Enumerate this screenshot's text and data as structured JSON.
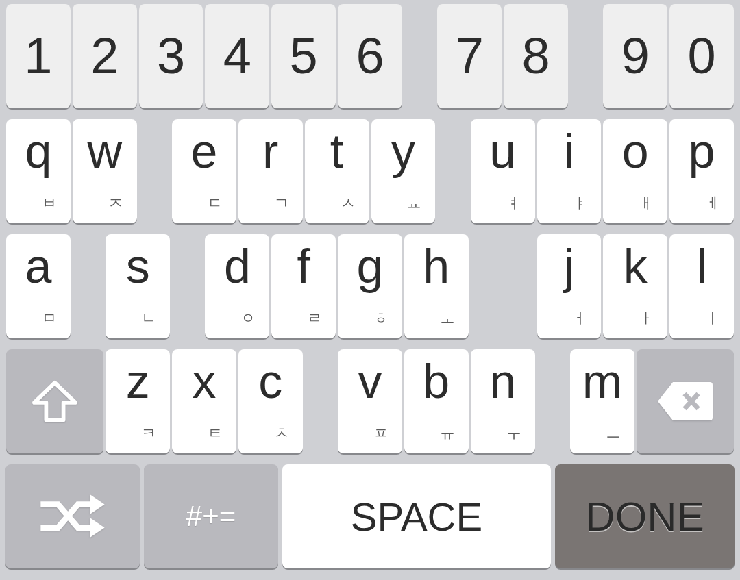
{
  "keyboard": {
    "rows": [
      {
        "keys": [
          {
            "kind": "digit",
            "label": "1"
          },
          {
            "kind": "digit",
            "label": "2"
          },
          {
            "kind": "digit",
            "label": "3"
          },
          {
            "kind": "digit",
            "label": "4"
          },
          {
            "kind": "digit",
            "label": "5"
          },
          {
            "kind": "digit",
            "label": "6"
          },
          {
            "kind": "digit",
            "label": "7"
          },
          {
            "kind": "digit",
            "label": "8"
          },
          {
            "kind": "digit",
            "label": "9"
          },
          {
            "kind": "digit",
            "label": "0"
          }
        ]
      },
      {
        "keys": [
          {
            "kind": "letter",
            "label": "q",
            "hangul": "ㅂ"
          },
          {
            "kind": "letter",
            "label": "w",
            "hangul": "ㅈ"
          },
          {
            "kind": "letter",
            "label": "e",
            "hangul": "ㄷ"
          },
          {
            "kind": "letter",
            "label": "r",
            "hangul": "ㄱ"
          },
          {
            "kind": "letter",
            "label": "t",
            "hangul": "ㅅ"
          },
          {
            "kind": "letter",
            "label": "y",
            "hangul": "ㅛ"
          },
          {
            "kind": "letter",
            "label": "u",
            "hangul": "ㅕ"
          },
          {
            "kind": "letter",
            "label": "i",
            "hangul": "ㅑ"
          },
          {
            "kind": "letter",
            "label": "o",
            "hangul": "ㅐ"
          },
          {
            "kind": "letter",
            "label": "p",
            "hangul": "ㅔ"
          }
        ]
      },
      {
        "keys": [
          {
            "kind": "letter",
            "label": "a",
            "hangul": "ㅁ"
          },
          {
            "kind": "letter",
            "label": "s",
            "hangul": "ㄴ"
          },
          {
            "kind": "letter",
            "label": "d",
            "hangul": "ㅇ"
          },
          {
            "kind": "letter",
            "label": "f",
            "hangul": "ㄹ"
          },
          {
            "kind": "letter",
            "label": "g",
            "hangul": "ㅎ"
          },
          {
            "kind": "letter",
            "label": "h",
            "hangul": "ㅗ"
          },
          {
            "kind": "letter",
            "label": "j",
            "hangul": "ㅓ"
          },
          {
            "kind": "letter",
            "label": "k",
            "hangul": "ㅏ"
          },
          {
            "kind": "letter",
            "label": "l",
            "hangul": "ㅣ"
          }
        ]
      },
      {
        "keys": [
          {
            "kind": "shift"
          },
          {
            "kind": "letter",
            "label": "z",
            "hangul": "ㅋ"
          },
          {
            "kind": "letter",
            "label": "x",
            "hangul": "ㅌ"
          },
          {
            "kind": "letter",
            "label": "c",
            "hangul": "ㅊ"
          },
          {
            "kind": "letter",
            "label": "v",
            "hangul": "ㅍ"
          },
          {
            "kind": "letter",
            "label": "b",
            "hangul": "ㅠ"
          },
          {
            "kind": "letter",
            "label": "n",
            "hangul": "ㅜ"
          },
          {
            "kind": "letter",
            "label": "m",
            "hangul": "ㅡ"
          },
          {
            "kind": "backspace"
          }
        ]
      },
      {
        "keys": [
          {
            "kind": "shuffle"
          },
          {
            "kind": "symbols",
            "label": "#+="
          },
          {
            "kind": "space",
            "label": "SPACE"
          },
          {
            "kind": "done",
            "label": "DONE"
          }
        ]
      }
    ]
  }
}
